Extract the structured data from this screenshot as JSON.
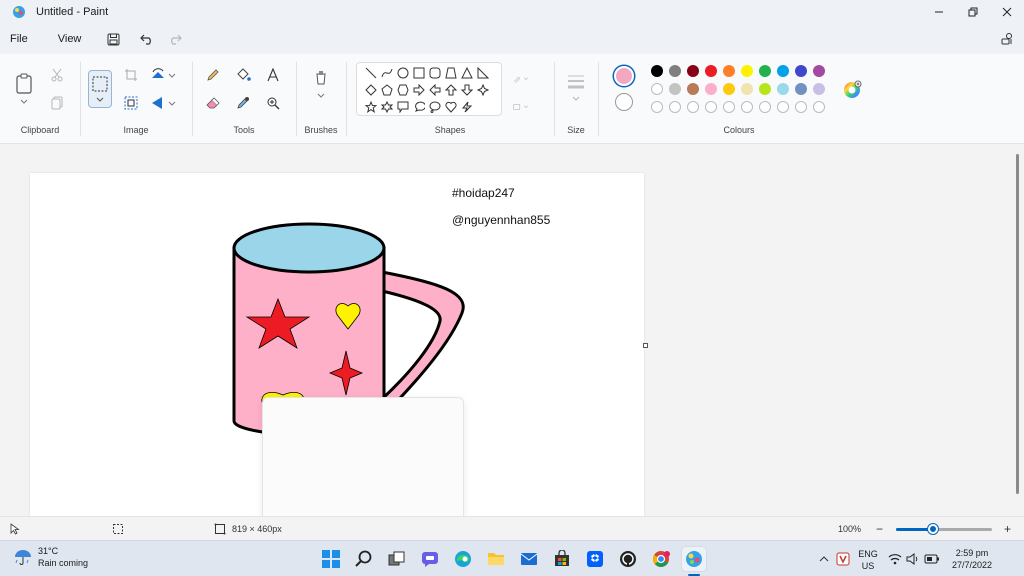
{
  "window": {
    "title": "Untitled - Paint",
    "minimize": "—",
    "restore": "❐",
    "close": "✕"
  },
  "menu": {
    "file": "File",
    "view": "View"
  },
  "ribbon": {
    "groups": {
      "clipboard": "Clipboard",
      "image": "Image",
      "tools": "Tools",
      "brushes": "Brushes",
      "shapes": "Shapes",
      "size": "Size",
      "colours": "Colours"
    },
    "colors": {
      "primary": "#f4a7c3",
      "secondary": "#ffffff",
      "row1": [
        "#000000",
        "#7f7f7f",
        "#880015",
        "#ed1c24",
        "#ff7f27",
        "#fff200",
        "#22b14c",
        "#00a2e8",
        "#3f48cc",
        "#a349a4"
      ],
      "row2": [
        "#ffffff",
        "#c3c3c3",
        "#b97a57",
        "#ffaec9",
        "#ffc90e",
        "#efe4b0",
        "#b5e61d",
        "#99d9ea",
        "#7092be",
        "#c8bfe7"
      ]
    }
  },
  "canvas": {
    "text_line1": "#hoidap247",
    "text_line2": "@nguyennhan855",
    "mug": {
      "body_color": "#fdb0c8",
      "rim_color": "#9bd5ea",
      "star_color": "#ed1c24",
      "heart_color": "#fff200"
    }
  },
  "statusbar": {
    "canvas_size": "819 × 460px",
    "zoom": "100%",
    "zoom_fraction": 0.39,
    "zoom_minus": "−",
    "zoom_plus": "+"
  },
  "taskbar": {
    "weather_temp": "31°C",
    "weather_desc": "Rain coming",
    "lang_line1": "ENG",
    "lang_line2": "US",
    "time": "2:59 pm",
    "date": "27/7/2022"
  }
}
